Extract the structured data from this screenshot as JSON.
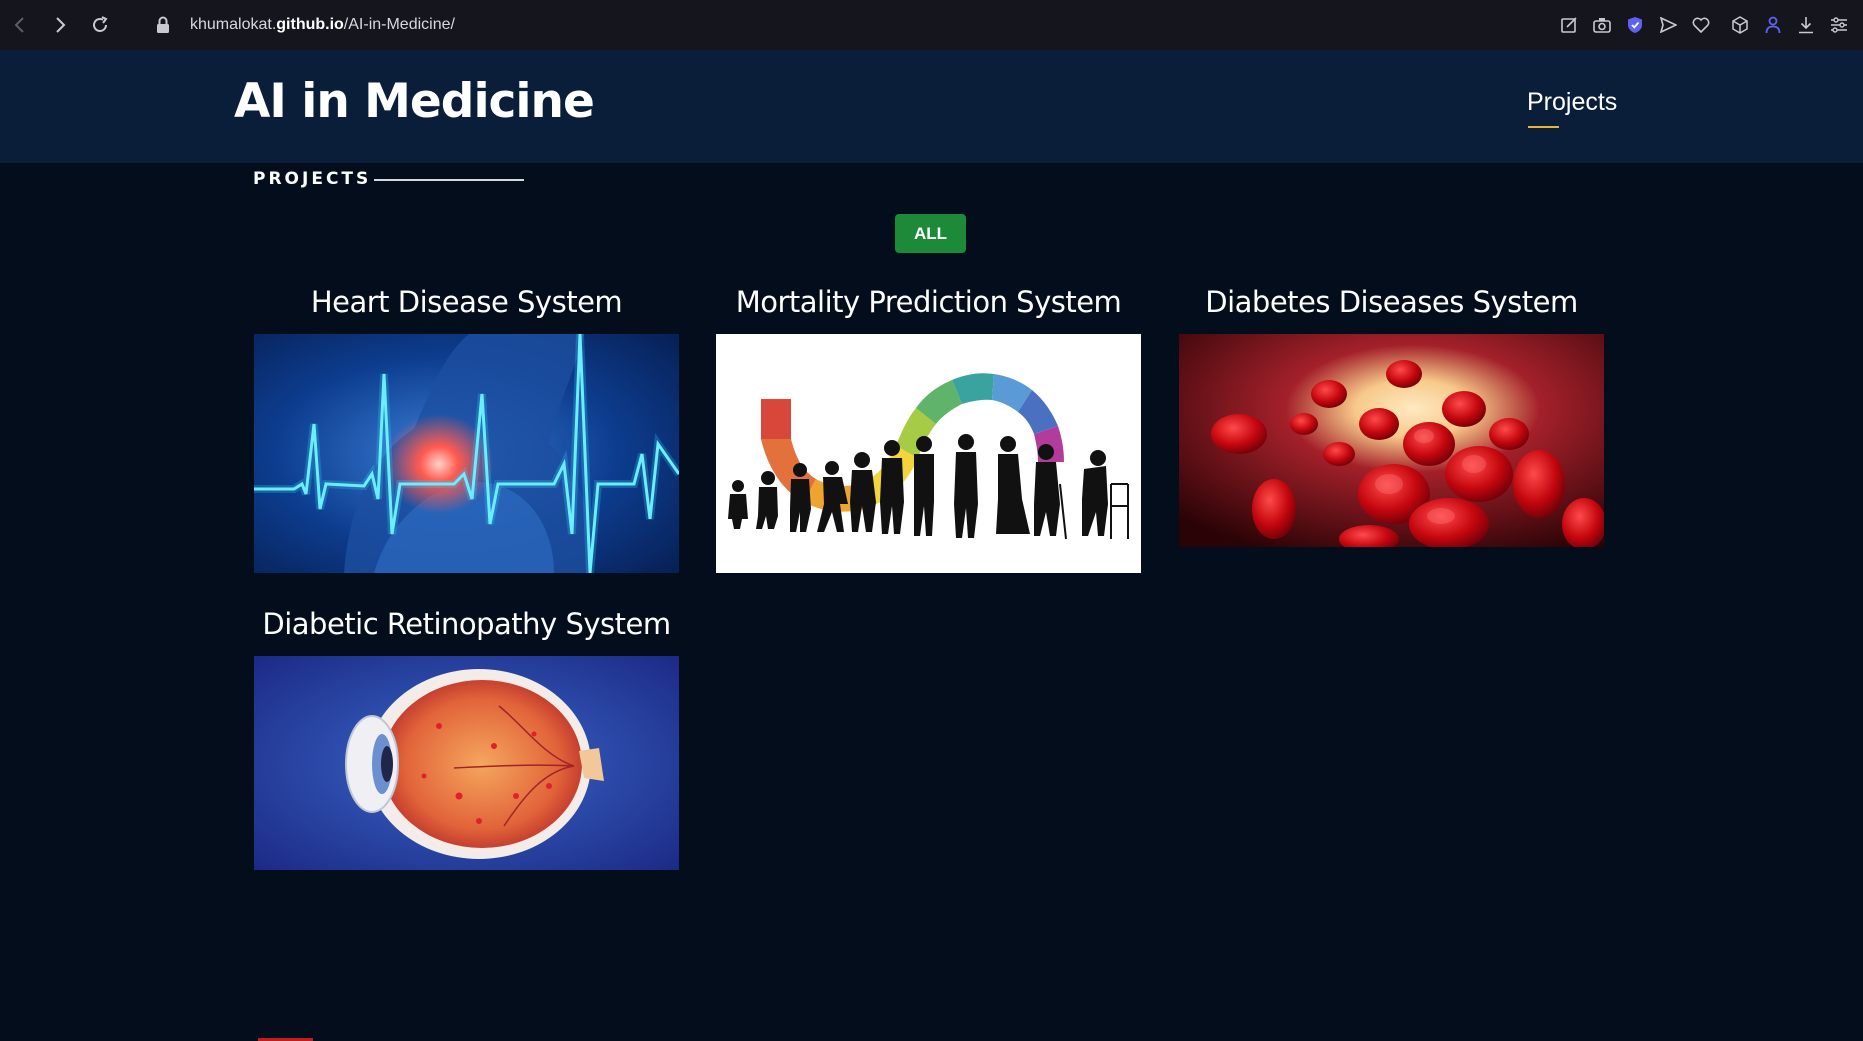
{
  "browser": {
    "url_prefix": "khumalokat.",
    "url_domain": "github.io",
    "url_path": "/AI-in-Medicine/",
    "icons": [
      "back-icon",
      "forward-icon",
      "reload-icon",
      "lock-icon",
      "edit-icon",
      "camera-icon",
      "shield-icon",
      "send-icon",
      "heart-icon",
      "cube-icon",
      "profile-icon",
      "download-icon",
      "menu-icon"
    ]
  },
  "header": {
    "brand": "AI in Medicine",
    "nav_link": "Projects",
    "accent_color": "#e5b536"
  },
  "section": {
    "title": "PROJECTS"
  },
  "filter": {
    "all_label": "ALL",
    "color": "#1d8a39"
  },
  "projects": [
    {
      "title": "Heart Disease System",
      "image": "heart-ecg-image"
    },
    {
      "title": "Mortality Prediction System",
      "image": "lifespan-silhouettes-image"
    },
    {
      "title": "Diabetes Diseases System",
      "image": "red-blood-cells-image"
    },
    {
      "title": "Diabetic Retinopathy System",
      "image": "eye-retina-image"
    }
  ]
}
